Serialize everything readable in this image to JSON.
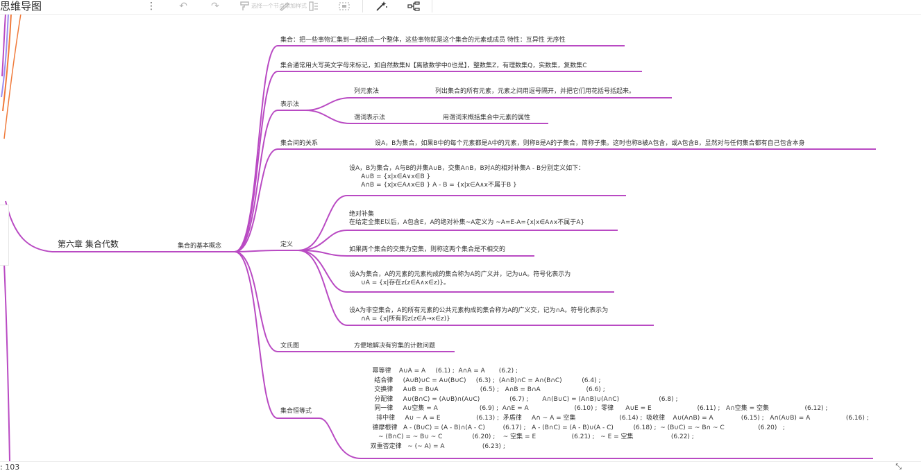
{
  "app": {
    "title": "思维导图"
  },
  "toolbar": {
    "more_icon": "⋮",
    "undo_icon": "↶",
    "redo_icon": "↷",
    "format_painter_hint": "选择一个节点添加样式",
    "format_painter_icon": "brush-icon",
    "colors": {
      "enabled": "#555555",
      "disabled": "#b5b5b5"
    }
  },
  "mindmap": {
    "root": "第六章 集合代数",
    "main": "集合的基本概念",
    "concept": "集合：把一些事物汇集到一起组成一个整体，这些事物就是这个集合的元素或成员      特性：互异性 无序性",
    "notation": "集合通常用大写英文字母来标记，如自然数集N【离散数学中0也是】，整数集Z，有理数集Q，实数集，复数集C",
    "representation": {
      "label": "表示法",
      "list_method": "列元素法",
      "list_desc": "列出集合的所有元素，元素之间用逗号隔开，并把它们用花括号括起来。",
      "predicate_method": "谓词表示法",
      "predicate_desc": "用谓词来概括集合中元素的属性"
    },
    "relation": {
      "label": "集合间的关系",
      "desc": "设A，B为集合，如果B中的每个元素都是A中的元素，则称B是A的子集合，简称子集。这时也称B被A包含，或A包含B，显然对与任何集合都有自己包含本身"
    },
    "definition": {
      "label": "定义",
      "union_intersection": "设A，B为集合，A与B的并集A∪B，交集A∩B，B对A的相对补集A - B分别定义如下：\n      A∪B = {x|x∈A∨x∈B }\n      A∩B = {x|x∈A∧x∈B } A - B = {x|x∈A∧x不属于B }",
      "absolute_complement": "绝对补集\n在给定全集E以后，A包含E，A的绝对补集~A定义为 ~A=E-A={x|x∈A∧x不属于A}",
      "disjoint": "如果两个集合的交集为空集，则称这两个集合是不相交的",
      "generalized_union": "设A为集合，A的元素的元素构成的集合称为A的广义并，记为∪A。符号化表示为\n      ∪A = {x|存在z(z∈A∧x∈z)}。",
      "generalized_intersection": "设A为非空集合，A的所有元素的公共元素构成的集合称为A的广义交，记为∩A。符号化表示为\n      ∩A = {x|所有的z(z∈A→x∈z)}"
    },
    "venn": {
      "label": "文氏图",
      "desc": "方便地解决有穷集的计数问题"
    },
    "identities": {
      "label": "集合恒等式",
      "text": "    幂等律    A∪A = A     (6.1) ;  A∩A = A       (6.2) ;\n     结合律     (A∪B)∪C = A∪(B∪C)     (6.3) ;  (A∩B)∩C = A∩(B∩C)          (6.4) ;\n     交换律     A∪B = B∪A                     (6.5) ;   A∩B = B∩A                       (6.6) ;\n     分配律     A∪(B∩C) = (A∪B)∩(A∪C)               (6.7) ;       A∩(B∪C) = (A∩B)∪(A∩C)                    (6.8) ;\n     同一律     A∪空集 = A                     (6.9) ;  A∩E = A                       (6.10) ;  零律      A∪E = E                       (6.11) ;   A∩空集 = 空集                  (6.12) ;\n      排中律     A∪ ~ A = E                  (6.13) ;  矛盾律     A∩ ~ A = 空集                      (6.14) ;  吸收律    A∪(A∩B) = A              (6.15) ;   A∩(A∪B) = A                  (6.16) ;\n    德摩根律   A - (B∪C) = (A - B)∩(A - C)         (6.17) ;   A - (B∩C) = (A - B)∪(A - C)          (6.18) ;  ~ (B∪C) = ~ B∩ ~ C                 (6.20)   ;\n       ~ (B∩C) = ~ B∪ ~ C               (6.20) ;    ~ 空集 = E                  (6.21) ;   ~ E = 空集                   (6.22) ;\n   双重否定律   ~ (~ A) = A                   (6.23) ;"
    },
    "colors": {
      "branch": "#b94ac3",
      "edge_lines": [
        "#9b8df0",
        "#f07a3a",
        "#b94ac3"
      ]
    }
  },
  "status": {
    "node_count": ": 103",
    "resize_icon": "⤡"
  }
}
